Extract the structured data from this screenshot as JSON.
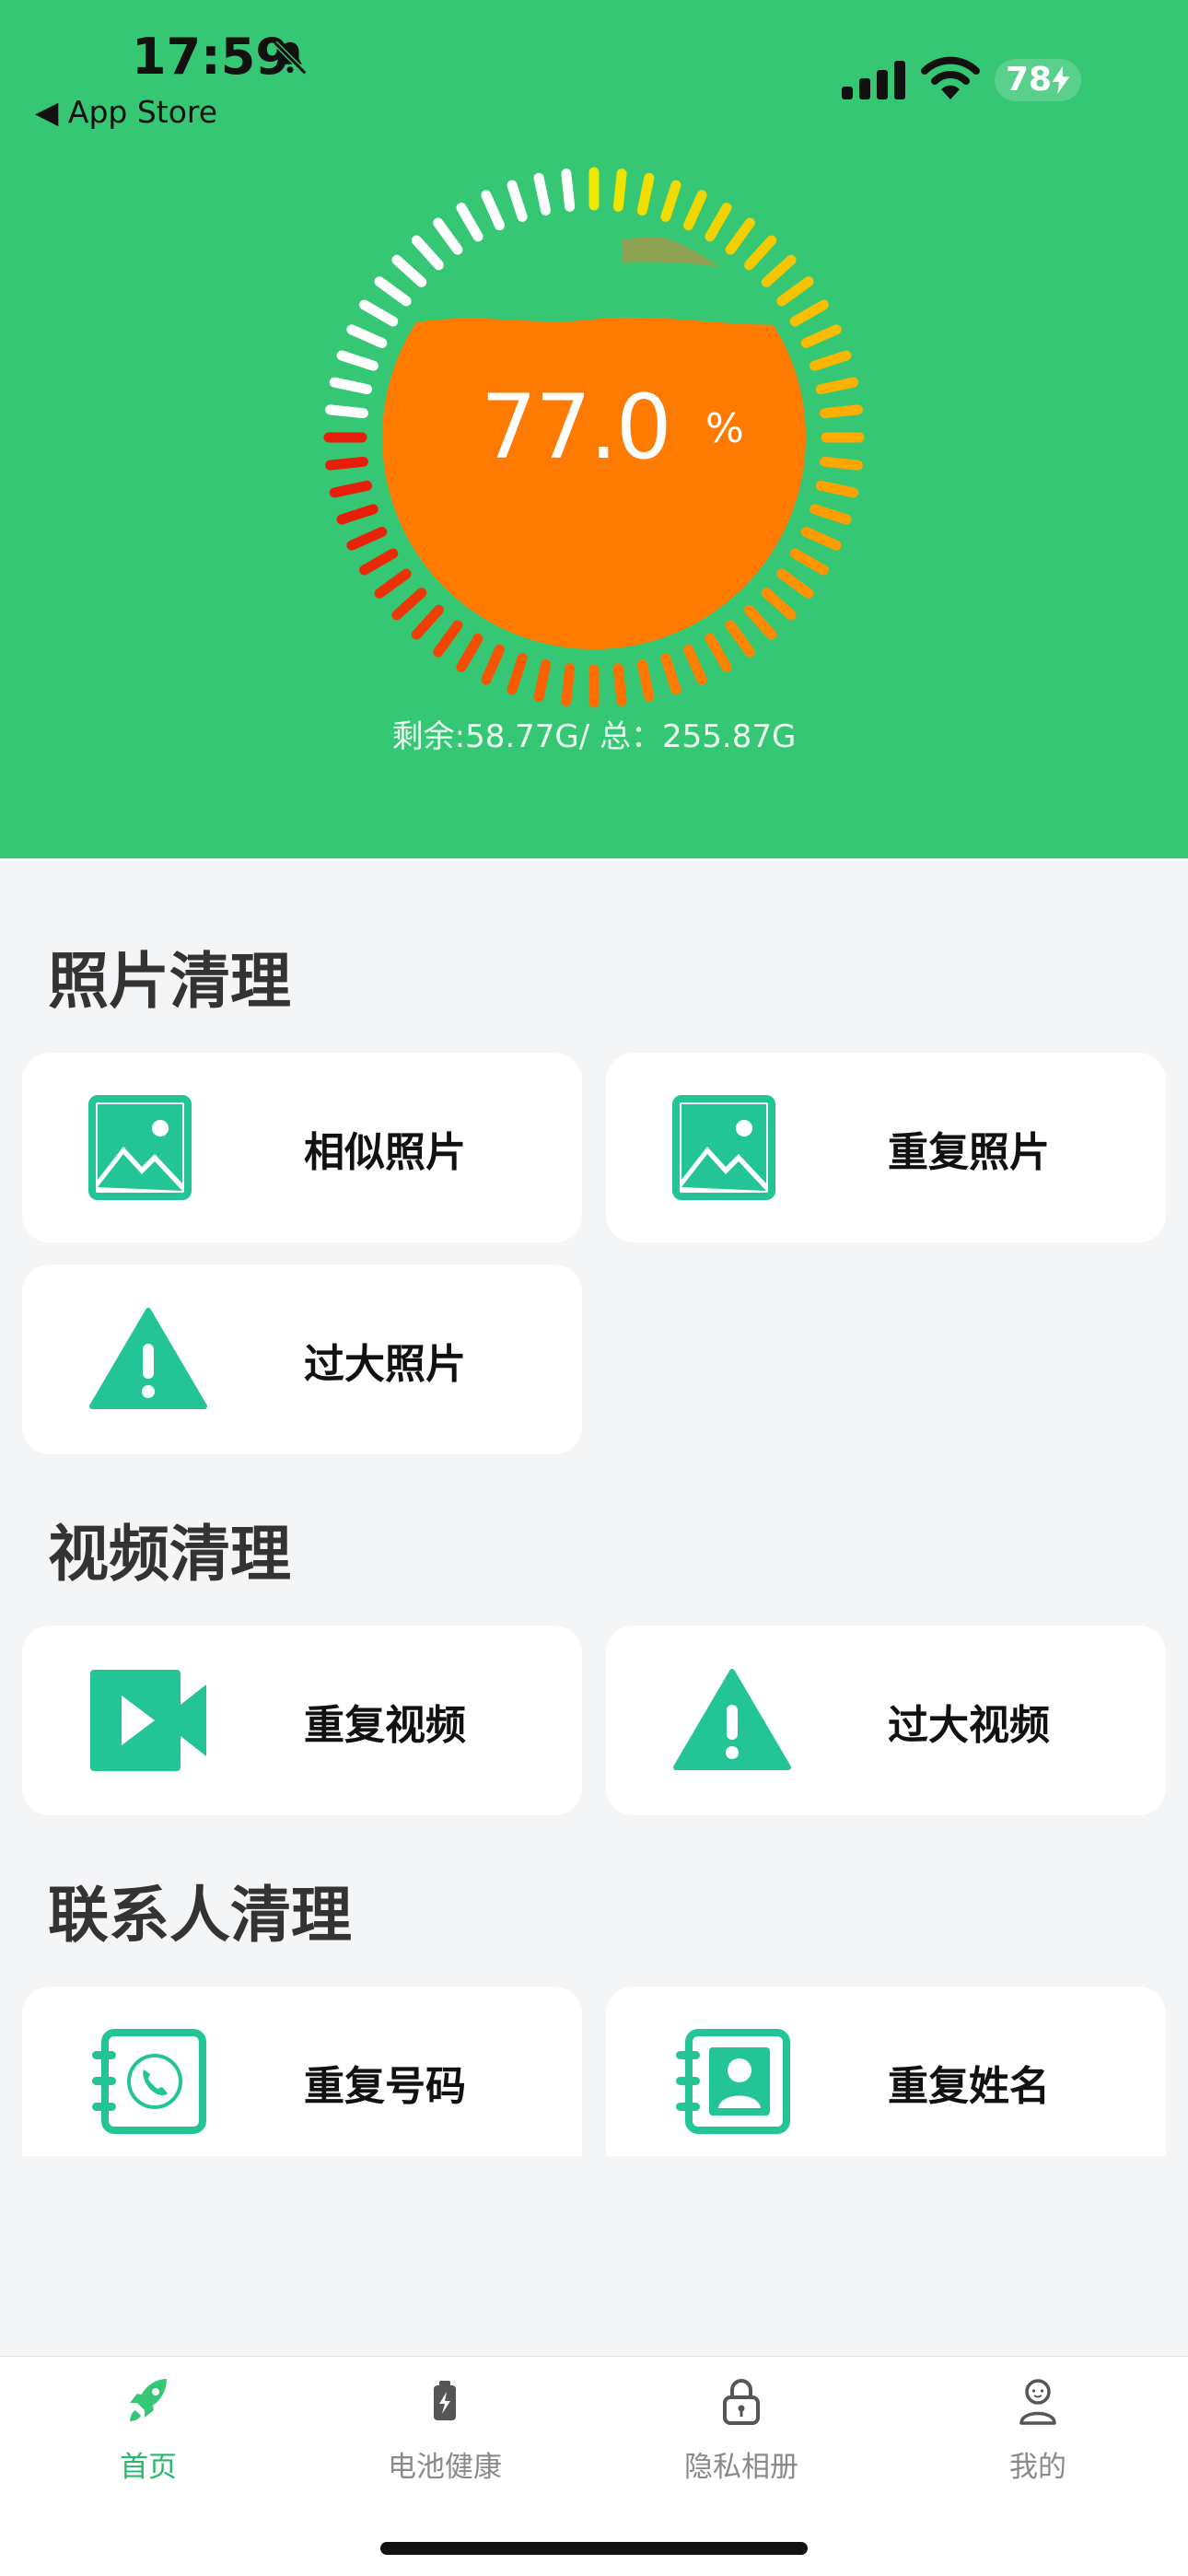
{
  "status_bar": {
    "time": "17:59",
    "back_label": "◀ App Store",
    "battery": "78"
  },
  "storage": {
    "percent_display": "77.0",
    "percent_unit": "%",
    "used_fraction": 0.77,
    "summary": "剩余:58.77G/ 总：255.87G"
  },
  "sections": {
    "photos": {
      "title": "照片清理",
      "items": [
        {
          "label": "相似照片",
          "icon": "image-icon"
        },
        {
          "label": "重复照片",
          "icon": "image-icon"
        },
        {
          "label": "过大照片",
          "icon": "warning-icon"
        }
      ]
    },
    "videos": {
      "title": "视频清理",
      "items": [
        {
          "label": "重复视频",
          "icon": "video-icon"
        },
        {
          "label": "过大视频",
          "icon": "warning-icon"
        }
      ]
    },
    "contacts": {
      "title": "联系人清理",
      "items": [
        {
          "label": "重复号码",
          "icon": "phone-book-icon"
        },
        {
          "label": "重复姓名",
          "icon": "contact-book-icon"
        }
      ]
    }
  },
  "tabbar": {
    "items": [
      {
        "label": "首页",
        "icon": "rocket-icon",
        "active": true
      },
      {
        "label": "电池健康",
        "icon": "battery-icon",
        "active": false
      },
      {
        "label": "隐私相册",
        "icon": "lock-icon",
        "active": false
      },
      {
        "label": "我的",
        "icon": "profile-icon",
        "active": false
      }
    ]
  },
  "colors": {
    "accent": "#35c774",
    "icon_teal": "#23c496",
    "gauge_fill": "#ff7a00"
  }
}
